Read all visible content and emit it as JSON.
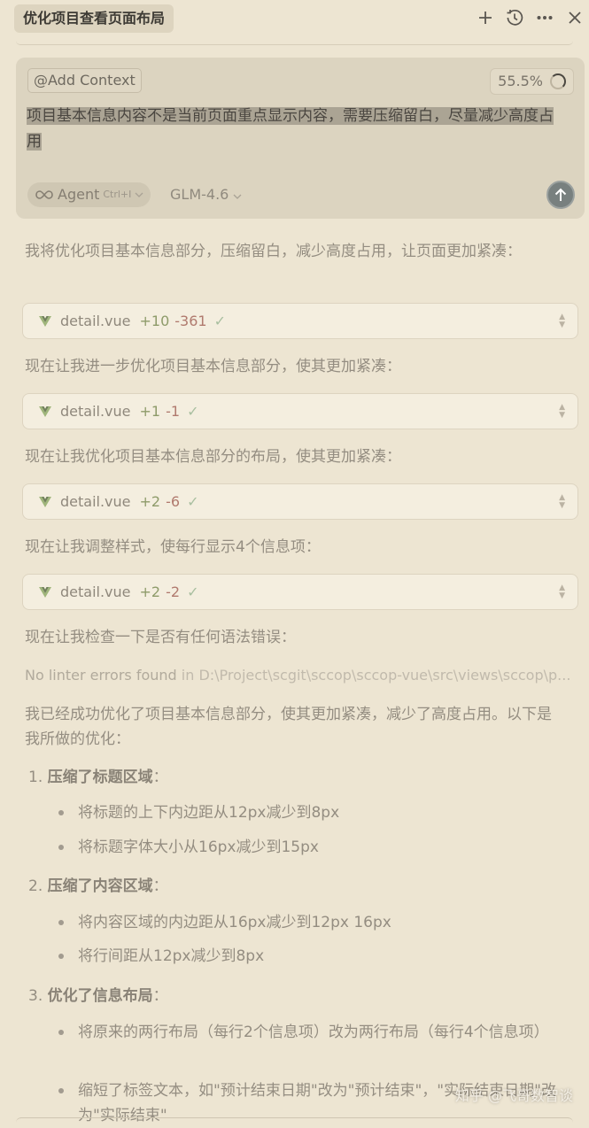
{
  "tab": {
    "title": "优化项目查看页面布局"
  },
  "toolbar": {
    "new_icon": "plus-icon",
    "history_icon": "history-icon",
    "more_icon": "more-icon",
    "close_icon": "close-icon"
  },
  "composer": {
    "add_context": "@Add Context",
    "context_percent": "55.5%",
    "prompt": "项目基本信息内容不是当前页面重点显示内容，需要压缩留白，尽量减少高度占用",
    "agent_label": "Agent",
    "agent_shortcut": "Ctrl+I",
    "model": "GLM-4.6"
  },
  "messages": {
    "m1": "我将优化项目基本信息部分，压缩留白，减少高度占用，让页面更加紧凑：",
    "m2": "现在让我进一步优化项目基本信息部分，使其更加紧凑：",
    "m3": "现在让我优化项目基本信息部分的布局，使其更加紧凑：",
    "m4": "现在让我调整样式，使每行显示4个信息项：",
    "m5": "现在让我检查一下是否有任何语法错误：",
    "summary": "我已经成功优化了项目基本信息部分，使其更加紧凑，减少了高度占用。以下是我所做的优化："
  },
  "edits": [
    {
      "file": "detail.vue",
      "added": "+10",
      "removed": "-361"
    },
    {
      "file": "detail.vue",
      "added": "+1",
      "removed": "-1"
    },
    {
      "file": "detail.vue",
      "added": "+2",
      "removed": "-6"
    },
    {
      "file": "detail.vue",
      "added": "+2",
      "removed": "-2"
    }
  ],
  "lint": {
    "status": "No linter errors found",
    "in": "in",
    "path": "D:\\Project\\scgit\\sccop\\sccop-vue\\src\\views\\sccop\\p..."
  },
  "list": {
    "s1": {
      "num": "1.",
      "title": "压缩了标题区域",
      "colon": "：",
      "b1": "将标题的上下内边距从12px减少到8px",
      "b2": "将标题字体大小从16px减少到15px"
    },
    "s2": {
      "num": "2.",
      "title": "压缩了内容区域",
      "colon": "：",
      "b1": "将内容区域的内边距从16px减少到12px 16px",
      "b2": "将行间距从12px减少到8px"
    },
    "s3": {
      "num": "3.",
      "title": "优化了信息布局",
      "colon": "：",
      "b1": "将原来的两行布局（每行2个信息项）改为两行布局（每行4个信息项）",
      "b2": "缩短了标签文本，如\"预计结束日期\"改为\"预计结束\"，\"实际结束日期\"改为\"实际结束\""
    }
  },
  "watermark": "知乎 @飞哥数智谈"
}
